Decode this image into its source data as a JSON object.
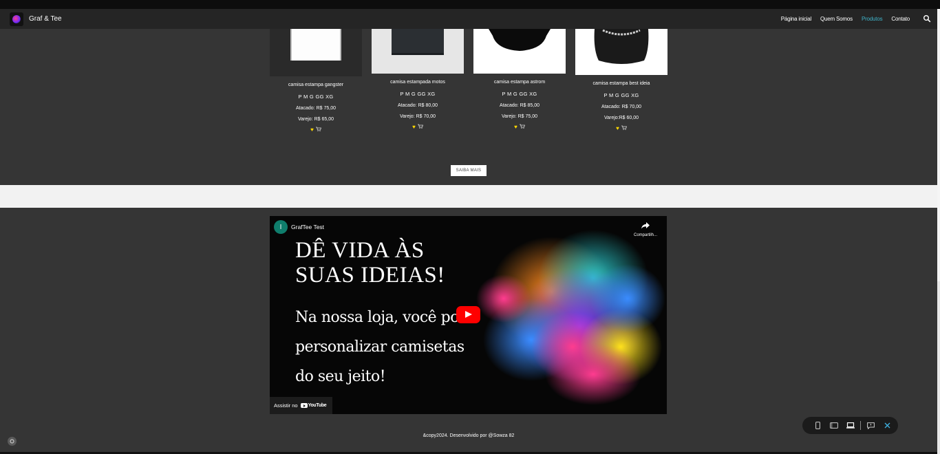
{
  "nav": {
    "brand": "Graf & Tee",
    "links": [
      "Página inicial",
      "Quem Somos",
      "Produtos",
      "Contato"
    ],
    "active_link": "Produtos",
    "accent_color": "#3fb1c7",
    "search_icon": "search-icon"
  },
  "products": [
    {
      "name": "camisa estampa gangster",
      "sizes": "P M G GG XG",
      "wholesale": "Atacado: R$ 75,00",
      "retail": "Varejo: R$ 65,00"
    },
    {
      "name": "camisa estampada motos",
      "sizes": "P M G GG XG",
      "wholesale": "Atacado: R$ 80,00",
      "retail": "Varejo: R$ 70,00"
    },
    {
      "name": "camisa estampa astrom",
      "sizes": "P M G GG XG",
      "wholesale": "Atacado: R$ 85,00",
      "retail": "Varejo: R$ 75,00"
    },
    {
      "name": "camisa estampa best ideia",
      "sizes": "P M G GG XG",
      "wholesale": "Atacado: R$ 70,00",
      "retail": "Varejo:R$ 60,00"
    }
  ],
  "icons": {
    "heart": "♥",
    "cart": "🛒"
  },
  "saiba_mais": "SAIBA MAIS",
  "video": {
    "avatar_letter": "I",
    "channel": "GrafTee Test",
    "share_label": "Compartilh...",
    "heading_line1": "DÊ VIDA ÀS",
    "heading_line2": "SUAS IDEIAS!",
    "text_line1": "Na nossa loja, você pod",
    "text_line2": "personalizar camisetas",
    "text_line3": "do seu jeito!",
    "watch_on": "Assistir no",
    "youtube": "YouTube"
  },
  "footer": "&copy2024. Desenvolvido por @Sowza 82"
}
